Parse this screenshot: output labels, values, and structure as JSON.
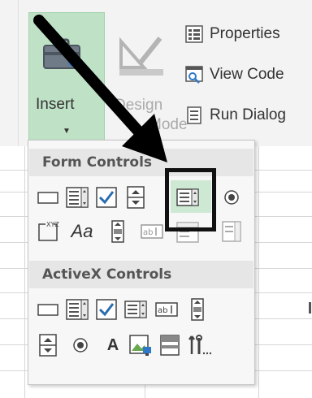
{
  "ribbon": {
    "insert_label": "Insert",
    "design_label_line1": "Design",
    "design_label_line2": "Mode",
    "commands": [
      {
        "label": "Properties",
        "icon": "properties-icon"
      },
      {
        "label": "View Code",
        "icon": "view-code-icon"
      },
      {
        "label": "Run Dialog",
        "icon": "run-dialog-icon"
      }
    ]
  },
  "dropdown": {
    "form_controls_title": "Form Controls",
    "activex_controls_title": "ActiveX Controls",
    "aa_label": "Aa",
    "label_a": "A",
    "form_controls": [
      "button-icon",
      "combo-box-icon",
      "checkbox-icon",
      "spin-button-icon",
      "list-box-icon",
      "option-button-icon",
      "group-box-icon",
      "label-icon",
      "scroll-bar-icon",
      "text-field-icon",
      "combo-list-edit-icon",
      "combo-drop-down-edit-icon"
    ],
    "activex_controls": [
      "command-button-icon",
      "combo-box-icon",
      "checkbox-icon",
      "list-box-icon",
      "text-box-icon",
      "scroll-bar-icon",
      "spin-button-icon",
      "option-button-icon",
      "label-icon",
      "image-icon",
      "toggle-button-icon",
      "more-controls-icon"
    ]
  },
  "colors": {
    "insert_bg": "#bfe2c7",
    "check_blue": "#2b6cb0",
    "highlight_border": "#111111",
    "arrow": "#000000"
  }
}
